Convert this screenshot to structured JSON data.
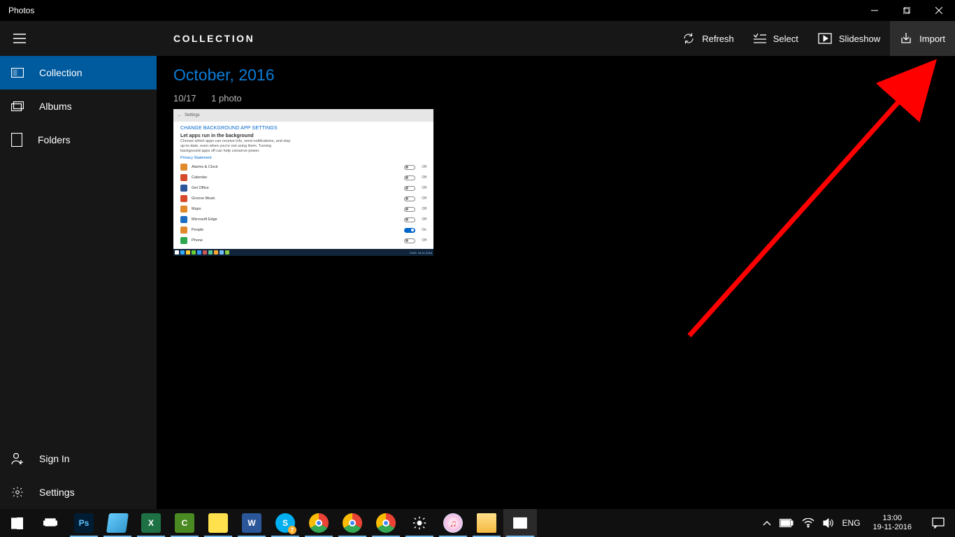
{
  "window": {
    "title": "Photos"
  },
  "commandbar": {
    "heading": "COLLECTION",
    "refresh": "Refresh",
    "select": "Select",
    "slideshow": "Slideshow",
    "import": "Import"
  },
  "sidebar": {
    "collection": "Collection",
    "albums": "Albums",
    "folders": "Folders",
    "signin": "Sign In",
    "settings": "Settings"
  },
  "content": {
    "month": "October, 2016",
    "date_short": "10/17",
    "count_label": "1 photo",
    "thumbnail": {
      "page_title_prefix": "CHANGE BACKGROUND APP SETTINGS",
      "heading": "Let apps run in the background",
      "description": "Choose which apps can receive info, send notifications, and stay up-to-date, even when you're not using them. Turning background apps off can help conserve power.",
      "privacy_link": "Privacy Statement",
      "rows": [
        {
          "name": "Alarms & Clock",
          "color": "#e08a2c",
          "on": false
        },
        {
          "name": "Calendar",
          "color": "#d64a2c",
          "on": false
        },
        {
          "name": "Get Office",
          "color": "#2b579a",
          "on": false
        },
        {
          "name": "Groove Music",
          "color": "#d64a2c",
          "on": false
        },
        {
          "name": "Maps",
          "color": "#e08a2c",
          "on": false
        },
        {
          "name": "Microsoft Edge",
          "color": "#1b6ec2",
          "on": false
        },
        {
          "name": "People",
          "color": "#e08a2c",
          "on": true
        },
        {
          "name": "Phone",
          "color": "#2fa84f",
          "on": false
        }
      ]
    }
  },
  "tray": {
    "language": "ENG",
    "time": "13:00",
    "date": "19-11-2016"
  }
}
